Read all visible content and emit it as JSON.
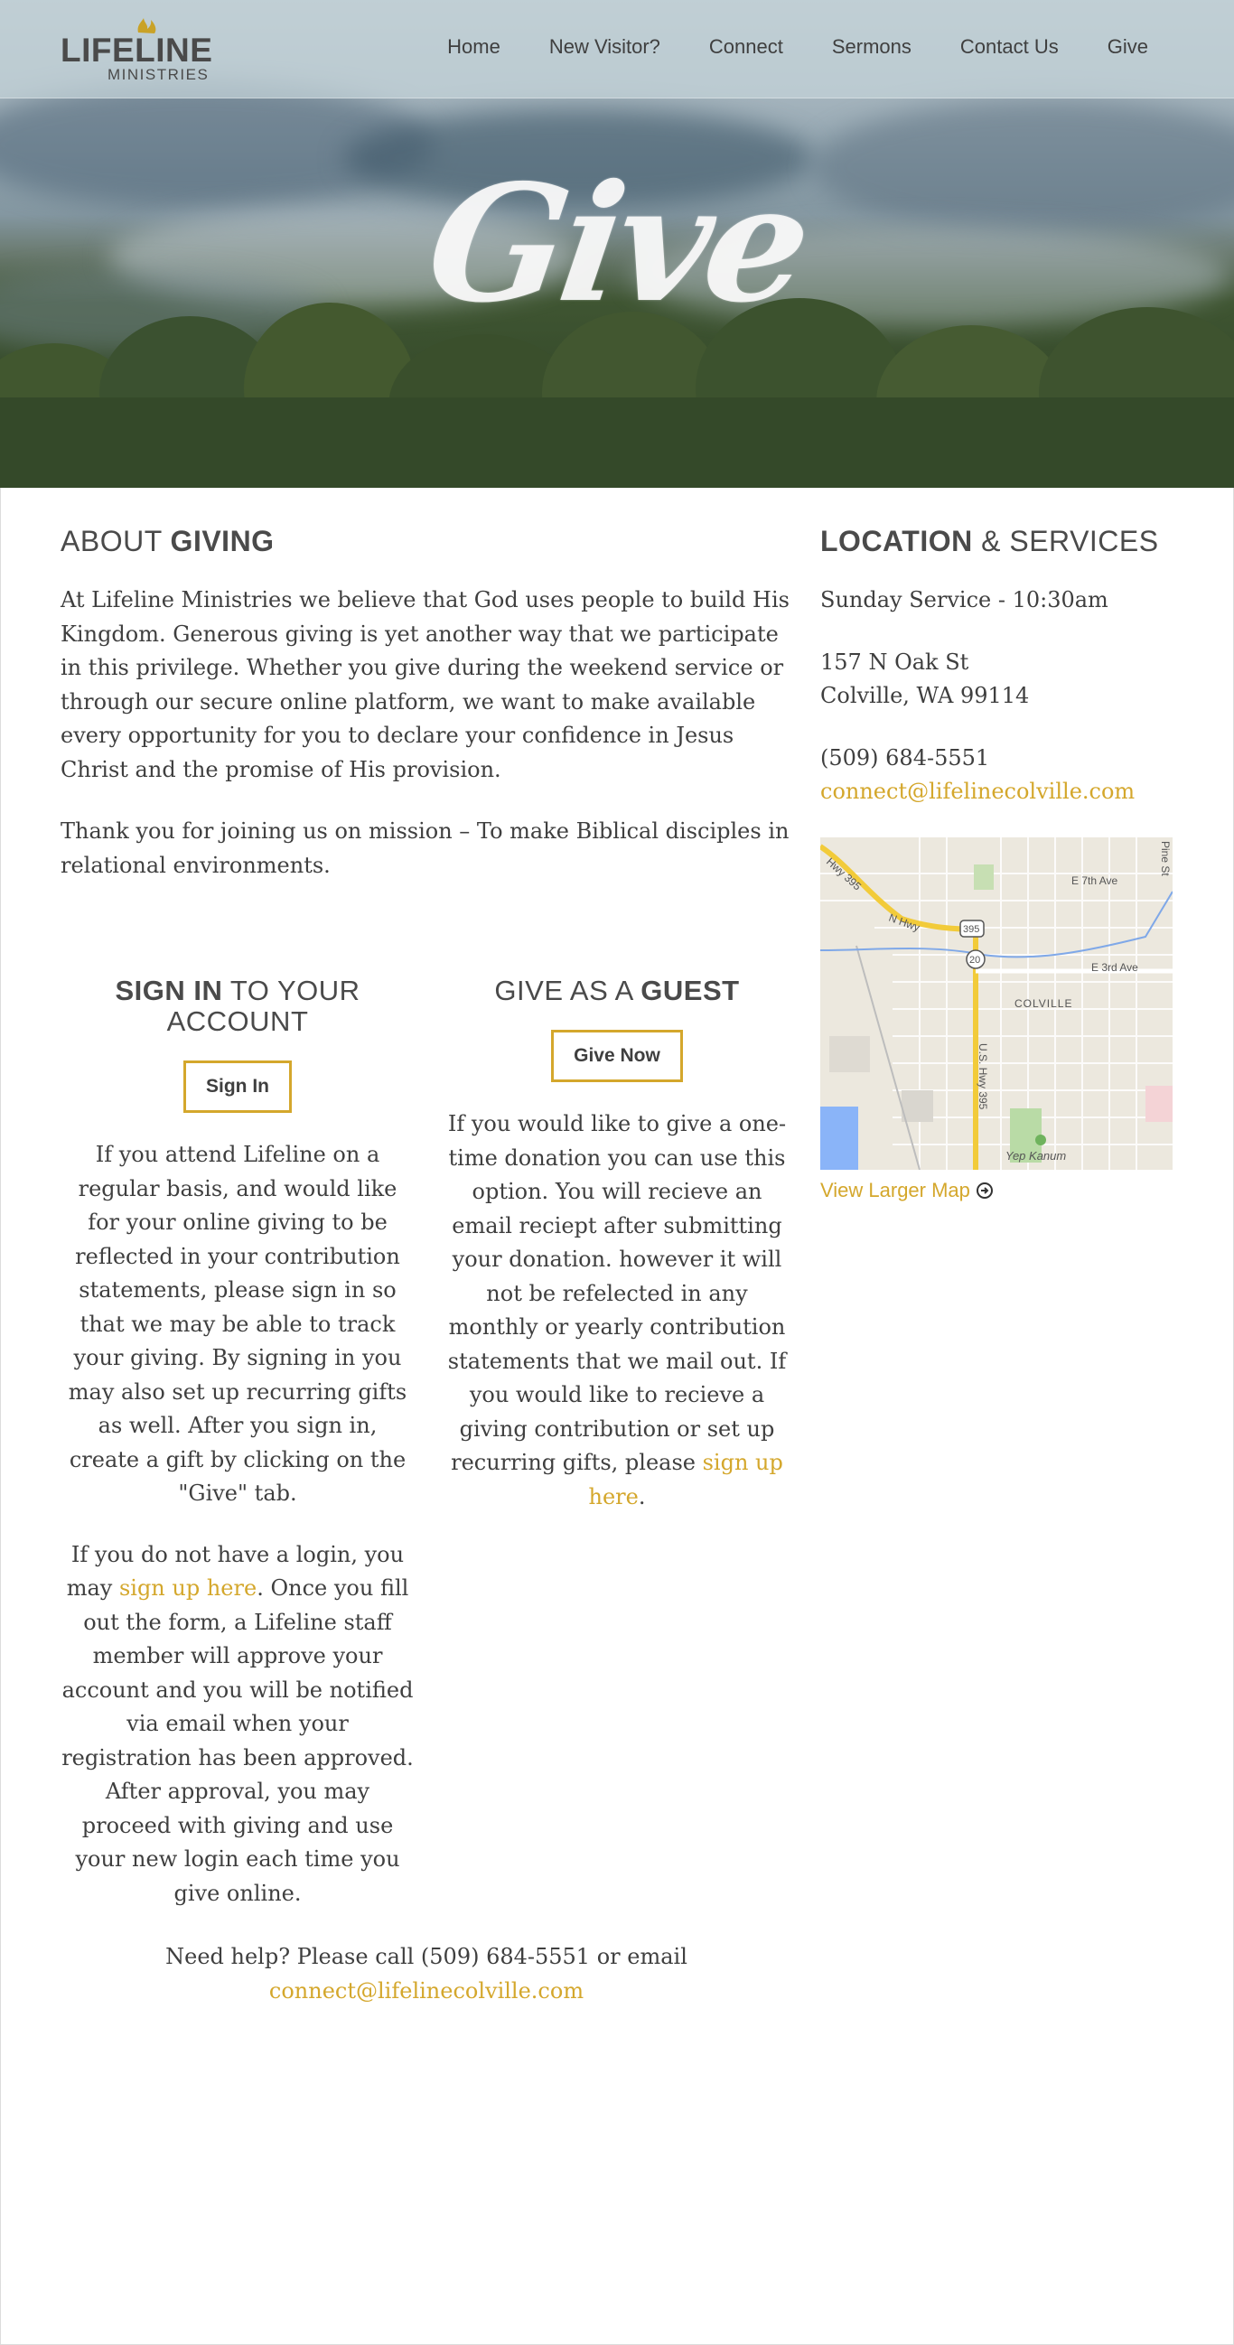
{
  "nav": {
    "logo_text": "LIFELINE",
    "logo_subtext": "MINISTRIES",
    "items": [
      "Home",
      "New Visitor?",
      "Connect",
      "Sermons",
      "Contact Us",
      "Give"
    ]
  },
  "hero": {
    "title": "Give"
  },
  "about": {
    "heading_light": "ABOUT",
    "heading_bold": "GIVING",
    "paragraph1": "At Lifeline Ministries we believe that God uses people to build His Kingdom. Generous giving is yet another way that we participate in this privilege. Whether you give during the weekend service or through our secure online platform, we want to make available every opportunity for you to declare your confidence in Jesus Christ and the promise of His provision.",
    "paragraph2": "Thank you for joining us on mission – To make Biblical disciples in relational environments."
  },
  "sidebar": {
    "heading_bold": "LOCATION",
    "heading_light": "& SERVICES",
    "service_time": "Sunday Service - 10:30am",
    "address_line1": "157 N Oak St",
    "address_line2": "Colville, WA 99114",
    "phone": "(509) 684-5551",
    "email": "connect@lifelinecolville.com",
    "map_labels": {
      "hwy395_diag": "Hwy 395",
      "n_hwy": "N Hwy",
      "e7th": "E 7th Ave",
      "e3rd": "E 3rd Ave",
      "colville": "COLVILLE",
      "us_hwy": "U.S. Hwy 395",
      "yep_kanum": "Yep Kanum",
      "pine": "Pine St",
      "shield_395": "395",
      "shield_20": "20"
    },
    "larger_map": "View Larger Map"
  },
  "signin": {
    "heading_bold": "SIGN IN",
    "heading_light": "TO YOUR ACCOUNT",
    "button": "Sign In",
    "paragraph1": "If you attend Lifeline on a regular basis, and would like for your online giving to be reflected in your contribution statements, please sign in so that we may be able to track your giving. By signing in you may also set up recurring gifts as well. After you sign in, create a gift by clicking on the \"Give\" tab.",
    "p2_before": "If you do not have a login, you may ",
    "p2_link": "sign up here",
    "p2_after": ". Once you fill out the form, a Lifeline staff member will approve your account and you will be notified via email when your registration has been approved. After approval, you may proceed with giving and use your new login each time you give online."
  },
  "guest": {
    "heading_light": "GIVE AS A",
    "heading_bold": "GUEST",
    "button": "Give Now",
    "p_before": "If you would like to give a one-time donation you can use this option. You will recieve an email reciept after submitting your donation. however it will not be refelected in any monthly or yearly contribution statements that we mail out. If you would like to recieve a giving contribution or set up recurring gifts, please ",
    "p_link": "sign up here",
    "p_after": "."
  },
  "help": {
    "text": "Need help? Please call (509) 684-5551 or email",
    "email": "connect@lifelinecolville.com"
  },
  "colors": {
    "accent": "#d4a72c",
    "text": "#3f3f3f"
  }
}
